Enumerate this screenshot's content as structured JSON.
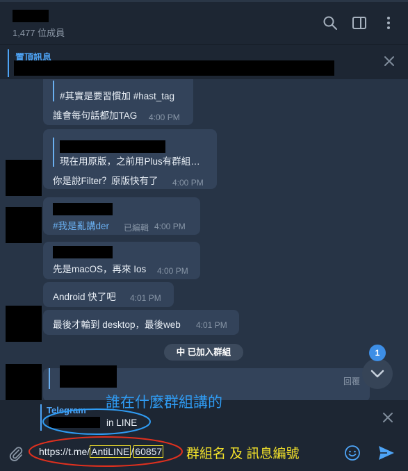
{
  "header": {
    "members": "1,477 位成員",
    "icons": [
      "search-icon",
      "sidebar-toggle-icon",
      "more-vertical-icon"
    ]
  },
  "pinned": {
    "label": "置頂訊息"
  },
  "messages": [
    {
      "quote": "#其實是要習慣加 #hast_tag",
      "text": "誰會每句話都加TAG",
      "time": "4:00 PM"
    },
    {
      "quote": "現在用原版，之前用Plus有群組…",
      "text": "你是說Filter？原版快有了",
      "time": "4:00 PM"
    },
    {
      "text": "#我是亂講der",
      "edited": "已編輯",
      "time": "4:00 PM"
    },
    {
      "text": "先是macOS，再來 Ios",
      "time": "4:00 PM"
    },
    {
      "text": "Android 快了吧",
      "time": "4:01 PM"
    },
    {
      "text": "最後才輪到 desktop，最後web",
      "time": "4:01 PM"
    }
  ],
  "service_message": "中 已加入群組",
  "last_message": {
    "action": "回覆"
  },
  "unread_badge": "1",
  "reply_preview": {
    "source": "Telegram",
    "text": "in LINE"
  },
  "input": {
    "value_prefix": "https://t.me/",
    "value_group": "AntiLINE",
    "value_sep": "/",
    "value_id": "60857"
  },
  "annotations": {
    "blue": "誰在什麼群組講的",
    "yellow": "群組名 及 訊息編號"
  },
  "colors": {
    "accent": "#4ea4f6",
    "annotation_blue": "#2f9cf4",
    "annotation_red": "#e0301e",
    "annotation_yellow": "#f3e22a"
  }
}
